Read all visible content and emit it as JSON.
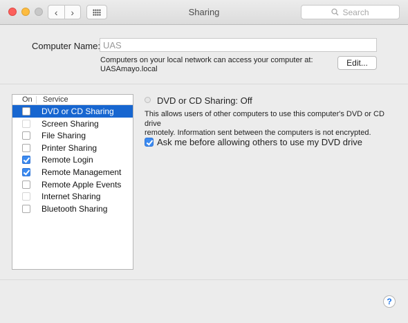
{
  "window": {
    "title": "Sharing",
    "search_placeholder": "Search",
    "back_glyph": "‹",
    "forward_glyph": "›"
  },
  "computer_name": {
    "label": "Computer Name:",
    "value": "UAS",
    "info_line1": "Computers on your local network can access your computer at:",
    "info_line2": "UASAmayo.local",
    "edit_button": "Edit..."
  },
  "service_list": {
    "header_on": "On",
    "header_service": "Service",
    "items": [
      {
        "label": "DVD or CD Sharing",
        "checked": false,
        "selected": true,
        "enabled": true
      },
      {
        "label": "Screen Sharing",
        "checked": false,
        "selected": false,
        "enabled": false
      },
      {
        "label": "File Sharing",
        "checked": false,
        "selected": false,
        "enabled": true
      },
      {
        "label": "Printer Sharing",
        "checked": false,
        "selected": false,
        "enabled": true
      },
      {
        "label": "Remote Login",
        "checked": true,
        "selected": false,
        "enabled": true
      },
      {
        "label": "Remote Management",
        "checked": true,
        "selected": false,
        "enabled": true
      },
      {
        "label": "Remote Apple Events",
        "checked": false,
        "selected": false,
        "enabled": true
      },
      {
        "label": "Internet Sharing",
        "checked": false,
        "selected": false,
        "enabled": false
      },
      {
        "label": "Bluetooth Sharing",
        "checked": false,
        "selected": false,
        "enabled": true
      }
    ]
  },
  "detail": {
    "status_title": "DVD or CD Sharing: Off",
    "description_line1": "This allows users of other computers to use this computer's DVD or CD drive",
    "description_line2": "remotely. Information sent between the computers is not encrypted.",
    "ask_label": "Ask me before allowing others to use my DVD drive",
    "ask_checked": true
  },
  "help": {
    "label": "?"
  },
  "colors": {
    "selection": "#1766d0",
    "checkbox_checked": "#3b8af0",
    "close": "#fc605c",
    "minimize": "#fdbc40",
    "zoom_disabled": "#c8c8c8"
  }
}
